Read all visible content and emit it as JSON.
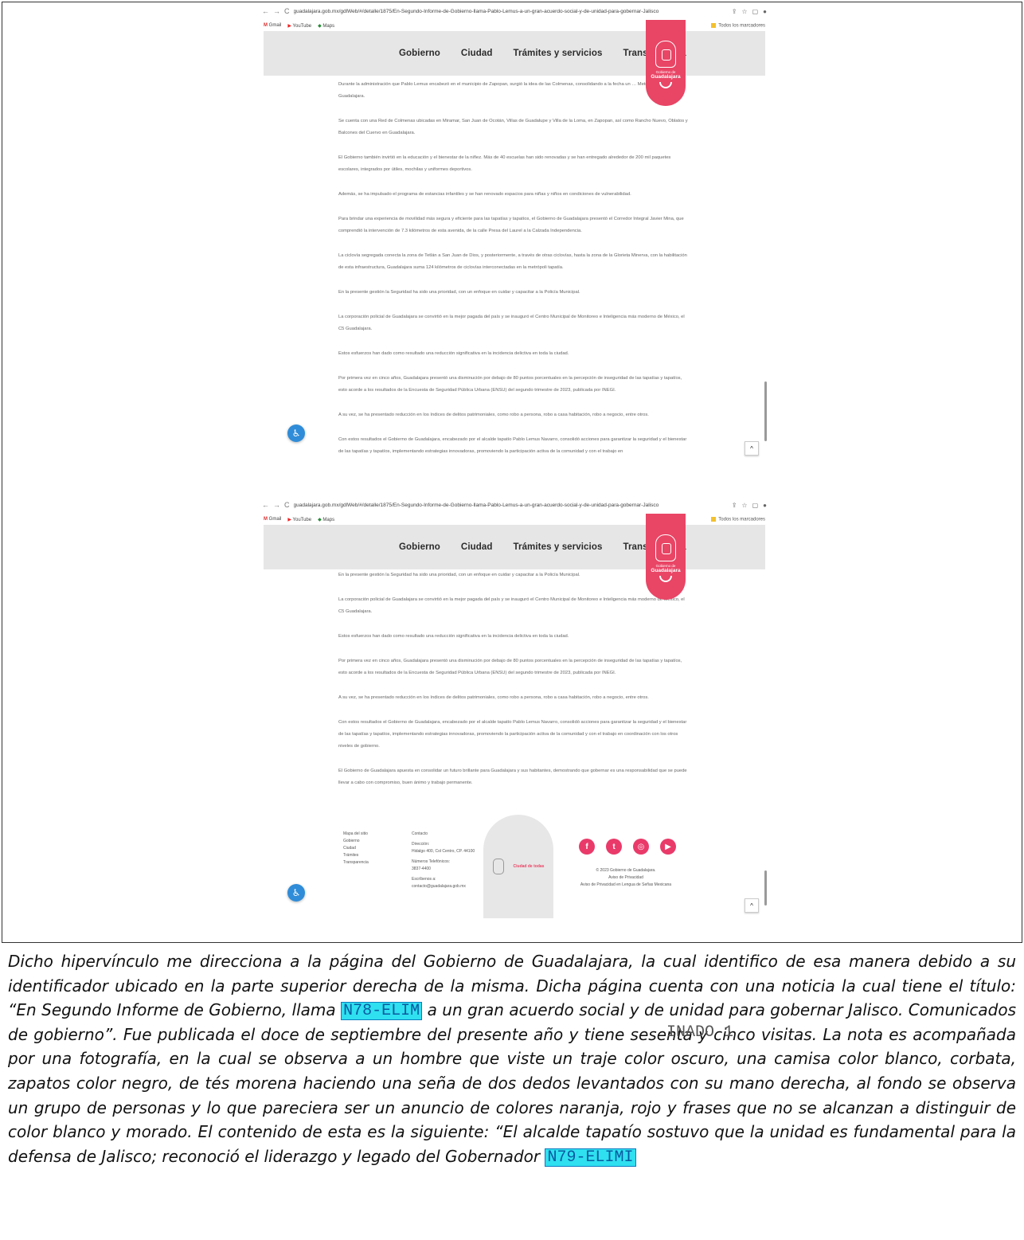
{
  "browser": {
    "url1": "guadalajara.gob.mx/gdlWeb/#/detalle/1875/En-Segundo-Informe-de-Gobierno-llama-Pablo-Lemus-a-un-gran-acuerdo-social-y-de-unidad-para-gobernar-Jalisco",
    "url2": "guadalajara.gob.mx/gdlWeb/#/detalle/1875/En-Segundo-Informe-de-Gobierno-llama-Pablo-Lemus-a-un-gran-acuerdo-social-y-de-unidad-para-gobernar-Jalisco",
    "bookmarks": [
      "Gmail",
      "YouTube",
      "Maps"
    ],
    "all_bookmarks": "Todos los marcadores"
  },
  "nav": {
    "items": [
      "Gobierno",
      "Ciudad",
      "Trámites y servicios",
      "Transparencia"
    ]
  },
  "badge": {
    "line1": "Gobierno de",
    "line2": "Guadalajara"
  },
  "shot1_paragraphs": [
    "Durante la administración que Pablo Lemus encabezó en el municipio de Zapopan, surgió la idea de las Colmenas, consolidando a la fecha un … Metropolitana de Guadalajara.",
    "Se cuenta con una Red de Colmenas ubicadas en Miramar, San Juan de Ocotán, Villas de Guadalupe y Villa de la Loma, en Zapopan, así como Rancho Nuevo, Oblatos y Balcones del Cuervo en Guadalajara.",
    "El Gobierno también invirtió en la educación y el bienestar de la niñez. Más de 40 escuelas han sido renovadas y se han entregado alrededor de 200 mil paquetes escolares, integrados por útiles, mochilas y uniformes deportivos.",
    "Además, se ha impulsado el programa de estancias infantiles y se han renovado espacios para niñas y niños en condiciones de vulnerabilidad.",
    "Para brindar una experiencia de movilidad más segura y eficiente para las tapatías y tapatíos, el Gobierno de Guadalajara presentó el Corredor Integral Javier Mina, que comprendió la intervención de 7.3 kilómetros de esta avenida, de la calle Presa del Laurel a la Calzada Independencia.",
    "La ciclovía segregada conecta la zona de Tetlán a San Juan de Dios, y posteriormente, a través de otras ciclovías, hasta la zona de la Glorieta Minerva, con la habilitación de esta infraestructura, Guadalajara suma 124 kilómetros de ciclovías interconectadas en la metrópoli tapatía.",
    "En la presente gestión la Seguridad ha sido una prioridad, con un enfoque en cuidar y capacitar a la Policía Municipal.",
    "La corporación policial de Guadalajara se convirtió en la mejor pagada del país y se inauguró el Centro Municipal de Monitoreo e Inteligencia más moderno de México, el C5 Guadalajara.",
    "Estos esfuerzos han dado como resultado una reducción significativa en la incidencia delictiva en toda la ciudad.",
    "Por primera vez en cinco años, Guadalajara presentó una disminución por debajo de 80 puntos porcentuales en la percepción de inseguridad de las tapatías y tapatíos, esto acorde a los resultados de la Encuesta de Seguridad Pública Urbana (ENSU) del segundo trimestre de 2023, publicada por INEGI.",
    "A su vez, se ha presentado reducción en los índices de delitos patrimoniales, como robo a persona, robo a casa habitación, robo a negocio, entre otros.",
    "Con estos resultados el Gobierno de Guadalajara, encabezado por el alcalde tapatío Pablo Lemus Navarro, consolidó acciones para garantizar la seguridad y el bienestar de las tapatías y tapatíos, implementando estrategias innovadoras, promoviendo la participación activa de la comunidad y con el trabajo en"
  ],
  "shot2_paragraphs": [
    "En la presente gestión la Seguridad ha sido una prioridad, con un enfoque en cuidar y capacitar a la Policía Municipal.",
    "La corporación policial de Guadalajara se convirtió en la mejor pagada del país y se inauguró el Centro Municipal de Monitoreo e Inteligencia más moderno de México, el C5 Guadalajara.",
    "Estos esfuerzos han dado como resultado una reducción significativa en la incidencia delictiva en toda la ciudad.",
    "Por primera vez en cinco años, Guadalajara presentó una disminución por debajo de 80 puntos porcentuales en la percepción de inseguridad de las tapatías y tapatíos, esto acorde a los resultados de la Encuesta de Seguridad Pública Urbana (ENSU) del segundo trimestre de 2023, publicada por INEGI.",
    "A su vez, se ha presentado reducción en los índices de delitos patrimoniales, como robo a persona, robo a casa habitación, robo a negocio, entre otros.",
    "Con estos resultados el Gobierno de Guadalajara, encabezado por el alcalde tapatío Pablo Lemus Navarro, consolidó acciones para garantizar la seguridad y el bienestar de las tapatías y tapatíos, implementando estrategias innovadoras, promoviendo la participación activa de la comunidad y con el trabajo en coordinación con los otros niveles de gobierno.",
    "El Gobierno de Guadalajara apuesta en consolidar un futuro brillante para Guadalajara y sus habitantes, demostrando que gobernar es una responsabilidad que se puede llevar a cabo con compromiso, buen ánimo y trabajo permanente."
  ],
  "footer": {
    "sitemap_title": "Mapa del sitio",
    "sitemap": [
      "Gobierno",
      "Ciudad",
      "Trámites",
      "Transparencia"
    ],
    "contact_title": "Contacto",
    "address_label": "Dirección:",
    "address": "Hidalgo 400, Col Centro, CP. 44100",
    "phone_label": "Números Telefónicos:",
    "phone": "3837-4400",
    "email_label": "Escríbenos a:",
    "email": "contacto@guadalajara.gob.mx",
    "card_logo": "Ciudad de todas",
    "copyright": "© 2023 Gobierno de Guadalajara.",
    "privacy": "Aviso de Privacidad",
    "privacy_lsm": "Aviso de Privacidad en Lengua de Señas Mexicana",
    "social": [
      "f",
      "t",
      "◎",
      "▶"
    ]
  },
  "body_text": {
    "part1": "Dicho hipervínculo me direcciona a la página del Gobierno de Guadalajara, la cual identifico de esa manera debido a su identificador ubicado en la parte superior derecha de la misma. Dicha página cuenta con una noticia la cual tiene el título: “En Segundo Informe de Gobierno, llama",
    "tag1": "N78-ELIM",
    "part2": "a un gran acuerdo social y de unidad para gobernar Jalisco. Comunicados de gobierno”. Fue publicada el doce de septiembre del presente año y tiene sesenta y cinco visitas. La nota es acompañada por una fotografía, en la cual se observa a un hombre que viste un traje color oscuro, una camisa color blanco, corbata, zapatos color negro, de tés morena haciendo una seña de dos dedos levantados con su mano derecha, al fondo se observa un grupo de personas y lo que pareciera ser un anuncio de colores naranja, rojo y frases que no se alcanzan a distinguir de color blanco y morado. El contenido de esta es la siguiente: “El alcalde tapatío sostuvo que la unidad es fundamental para la defensa de Jalisco; reconoció el liderazgo y legado del Gobernador",
    "tag2": "N79-ELIMI",
    "overlay": "INADO 1"
  }
}
